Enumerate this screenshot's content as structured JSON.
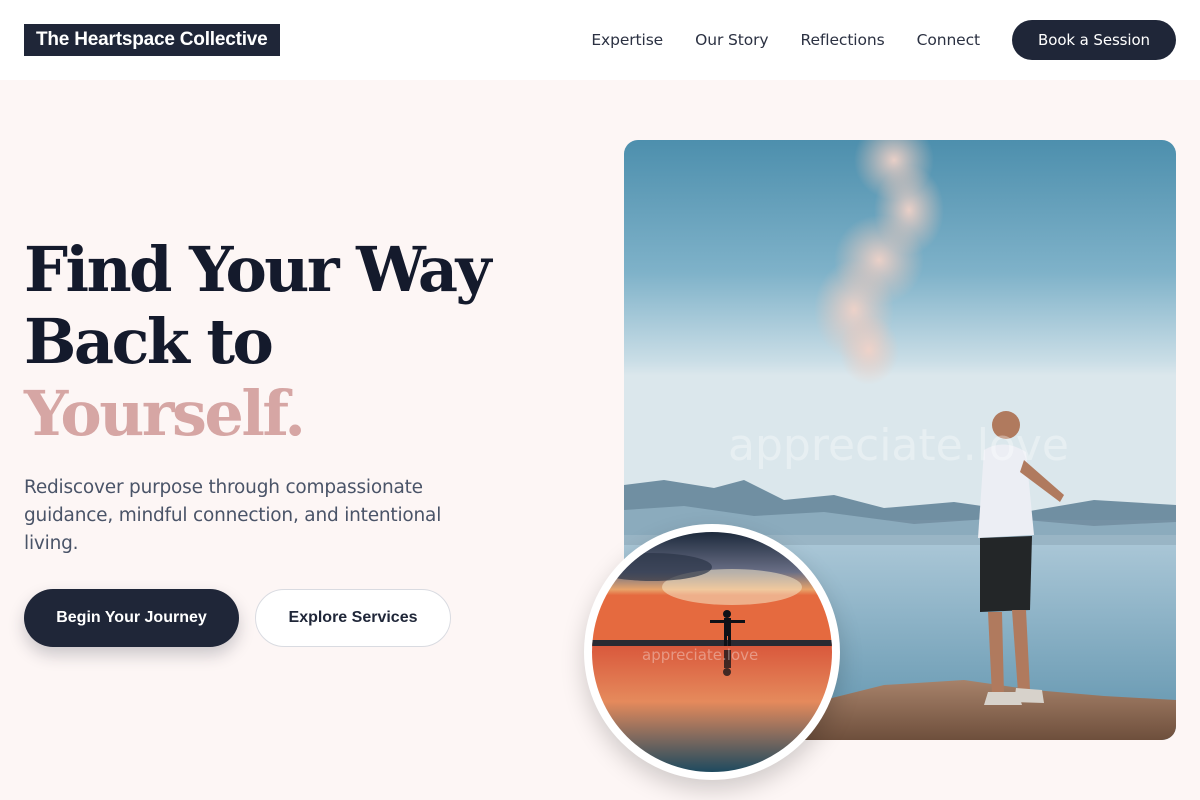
{
  "header": {
    "logo": "The Heartspace Collective",
    "nav": [
      {
        "label": "Expertise"
      },
      {
        "label": "Our Story"
      },
      {
        "label": "Reflections"
      },
      {
        "label": "Connect"
      }
    ],
    "cta_label": "Book a Session"
  },
  "hero": {
    "headline_line1": "Find Your Way",
    "headline_line2": "Back to",
    "headline_accent": "Yourself.",
    "subtext": "Rediscover purpose through compassionate guidance, mindful connection, and intentional living.",
    "primary_button": "Begin Your Journey",
    "secondary_button": "Explore Services"
  },
  "images": {
    "main_watermark": "appreciate.love",
    "circle_watermark": "appreciate.love"
  },
  "colors": {
    "navy": "#1f2638",
    "accent_pink": "#d6a6a4",
    "background": "#fdf6f5"
  }
}
